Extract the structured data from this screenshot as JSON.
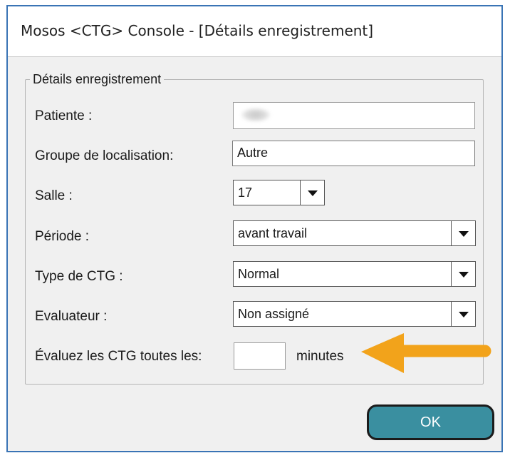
{
  "window": {
    "title": "Mosos <CTG> Console - [Détails enregistrement]"
  },
  "group": {
    "legend": "Détails enregistrement"
  },
  "form": {
    "patient_label": "Patiente :",
    "patient_value": "",
    "location_group_label": "Groupe de localisation:",
    "location_group_value": "Autre",
    "room_label": "Salle :",
    "room_value": "17",
    "period_label": "Période :",
    "period_value": "avant travail",
    "ctg_type_label": "Type de CTG :",
    "ctg_type_value": "Normal",
    "evaluator_label": "Evaluateur :",
    "evaluator_value": "Non assigné",
    "interval_label": "Évaluez les CTG toutes les:",
    "interval_value": "",
    "interval_unit": "minutes"
  },
  "buttons": {
    "ok_label": "OK"
  },
  "annotation": {
    "arrow_color": "#f2a31b",
    "arrow_icon": "arrow-left-icon"
  },
  "colors": {
    "window_border": "#3a74b5",
    "ok_button": "#3a8fa0"
  }
}
